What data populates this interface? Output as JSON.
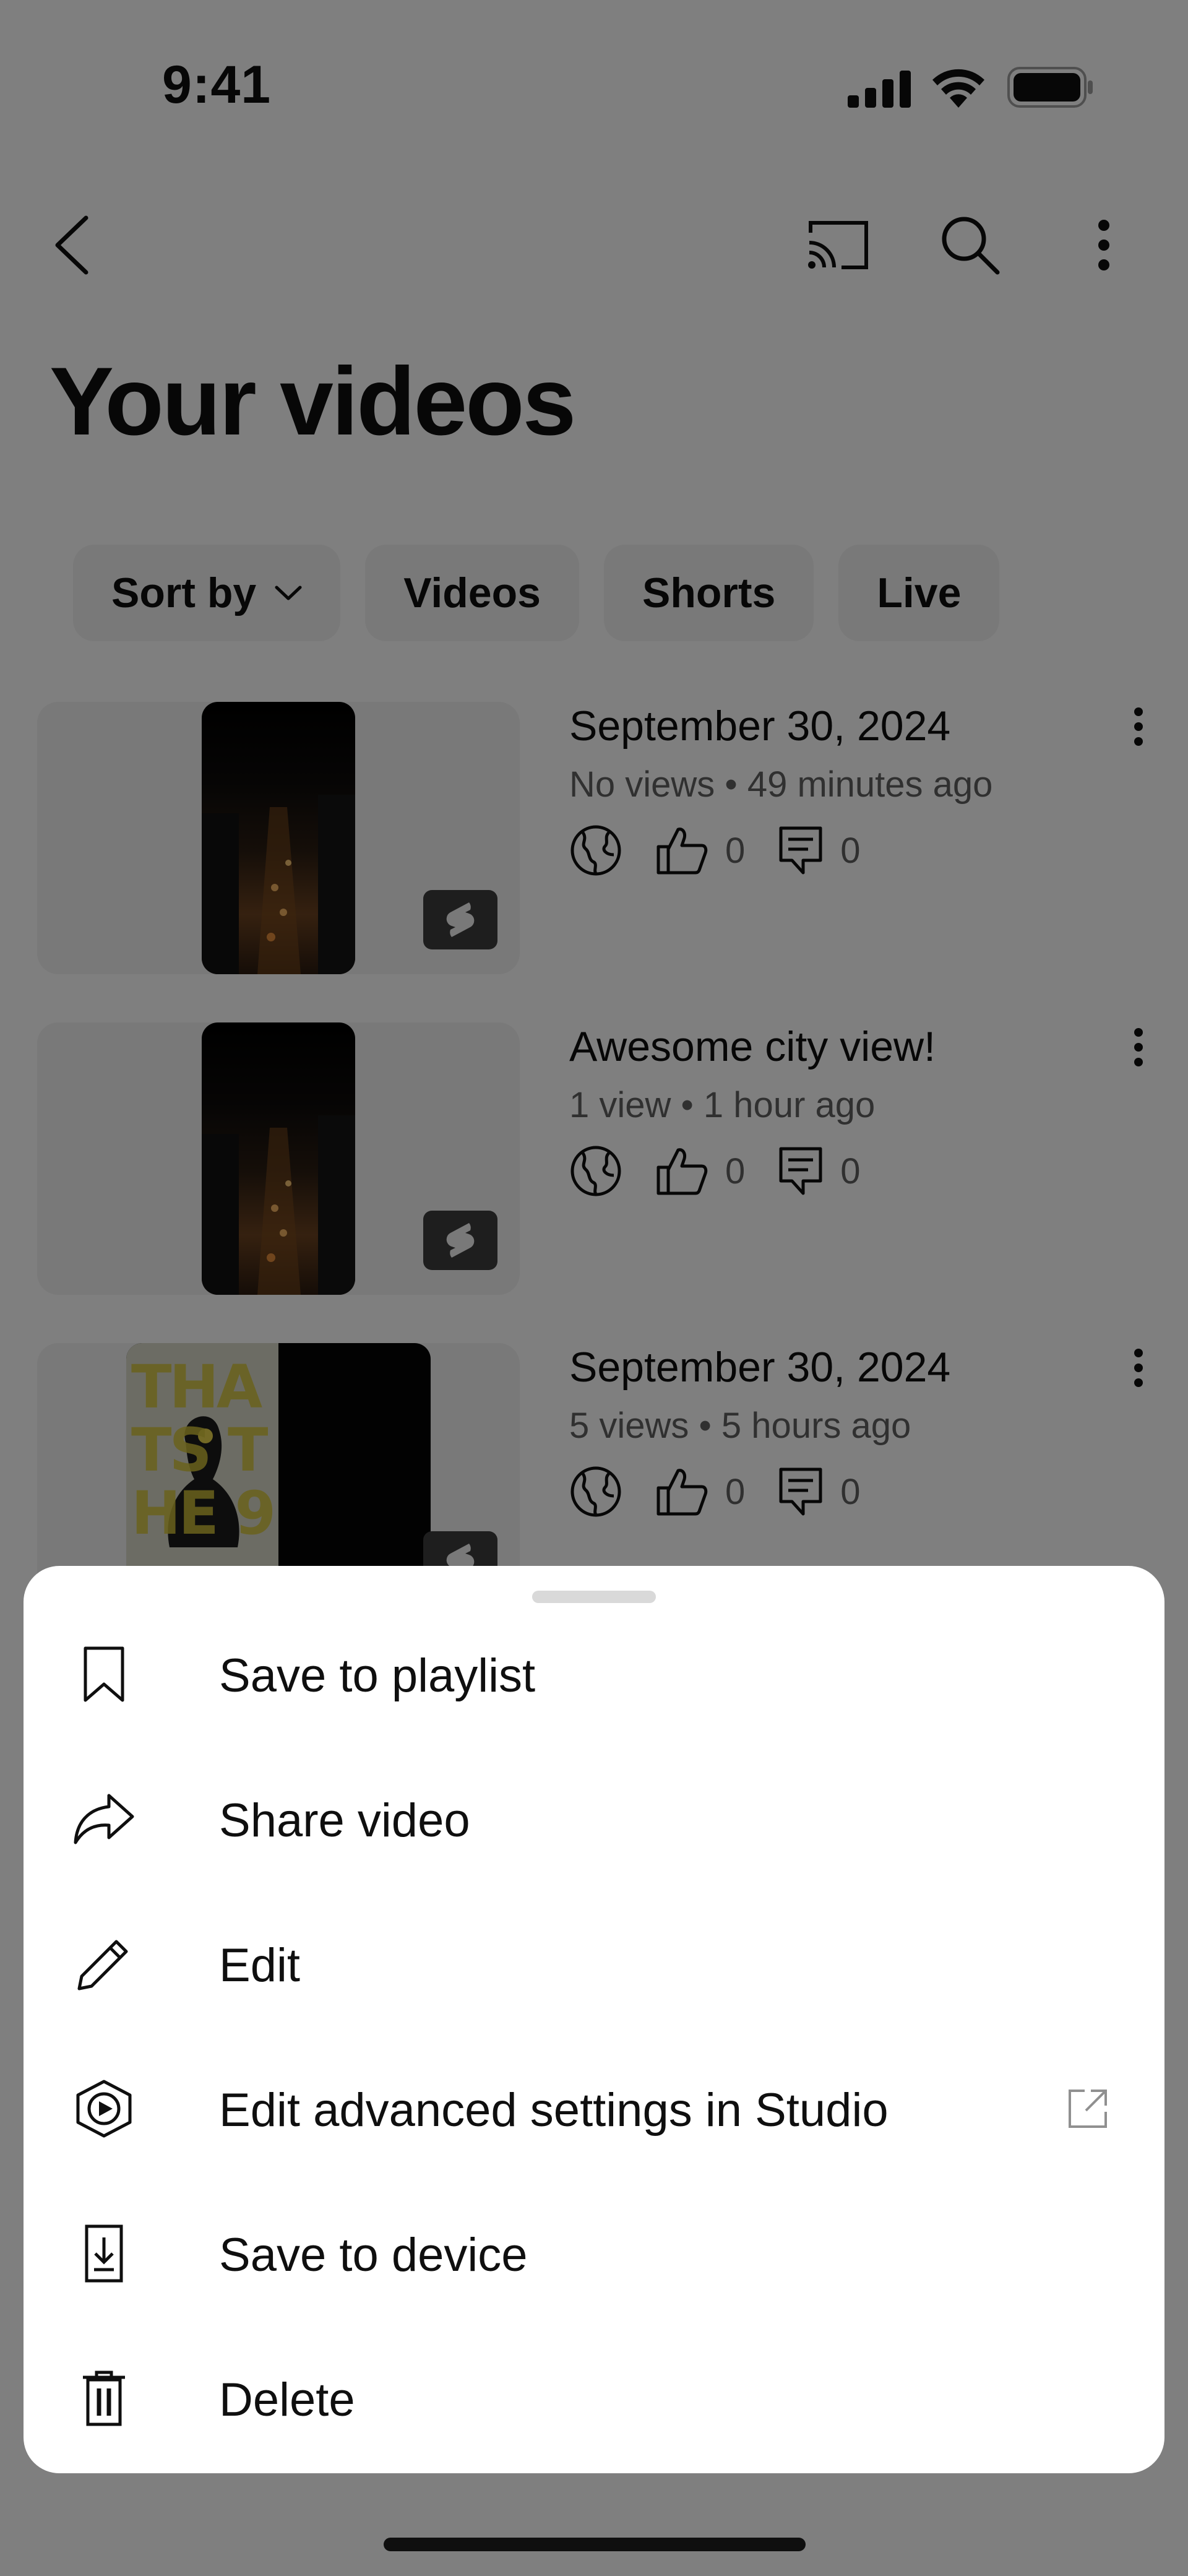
{
  "status_bar": {
    "time": "9:41",
    "icons": [
      "cellular-signal-icon",
      "wifi-icon",
      "battery-icon"
    ]
  },
  "app_bar": {
    "back_icon": "chevron-left-icon",
    "actions": [
      "cast-icon",
      "search-icon",
      "more-vertical-icon"
    ]
  },
  "page": {
    "title": "Your videos"
  },
  "chips": [
    {
      "label": "Sort by",
      "icon": "chevron-down-icon"
    },
    {
      "label": "Videos"
    },
    {
      "label": "Shorts"
    },
    {
      "label": "Live"
    }
  ],
  "videos": [
    {
      "title": "September 30, 2024",
      "meta": "No views • 49 minutes ago",
      "likes": "0",
      "comments": "0",
      "visibility_icon": "public-globe-icon",
      "badge_icon": "shorts-icon"
    },
    {
      "title": "Awesome city view!",
      "meta": "1 view • 1 hour ago",
      "likes": "0",
      "comments": "0",
      "visibility_icon": "public-globe-icon",
      "badge_icon": "shorts-icon"
    },
    {
      "title": "September 30, 2024",
      "meta": "5 views • 5 hours ago",
      "likes": "0",
      "comments": "0",
      "visibility_icon": "public-globe-icon",
      "badge_icon": "shorts-icon",
      "thumbnail_text": "THATS THE 9"
    }
  ],
  "sheet": {
    "items": [
      {
        "label": "Save to playlist",
        "icon": "bookmark-icon"
      },
      {
        "label": "Share video",
        "icon": "share-arrow-icon"
      },
      {
        "label": "Edit",
        "icon": "pencil-icon"
      },
      {
        "label": "Edit advanced settings in Studio",
        "icon": "studio-icon",
        "trailing_icon": "external-link-icon"
      },
      {
        "label": "Save to device",
        "icon": "download-to-device-icon"
      },
      {
        "label": "Delete",
        "icon": "trash-icon"
      }
    ]
  },
  "colors": {
    "text_primary": "#0f0f0f",
    "text_secondary": "#606060",
    "chip_bg": "#f2f2f2",
    "scrim": "#000000",
    "sheet_bg": "#ffffff"
  }
}
